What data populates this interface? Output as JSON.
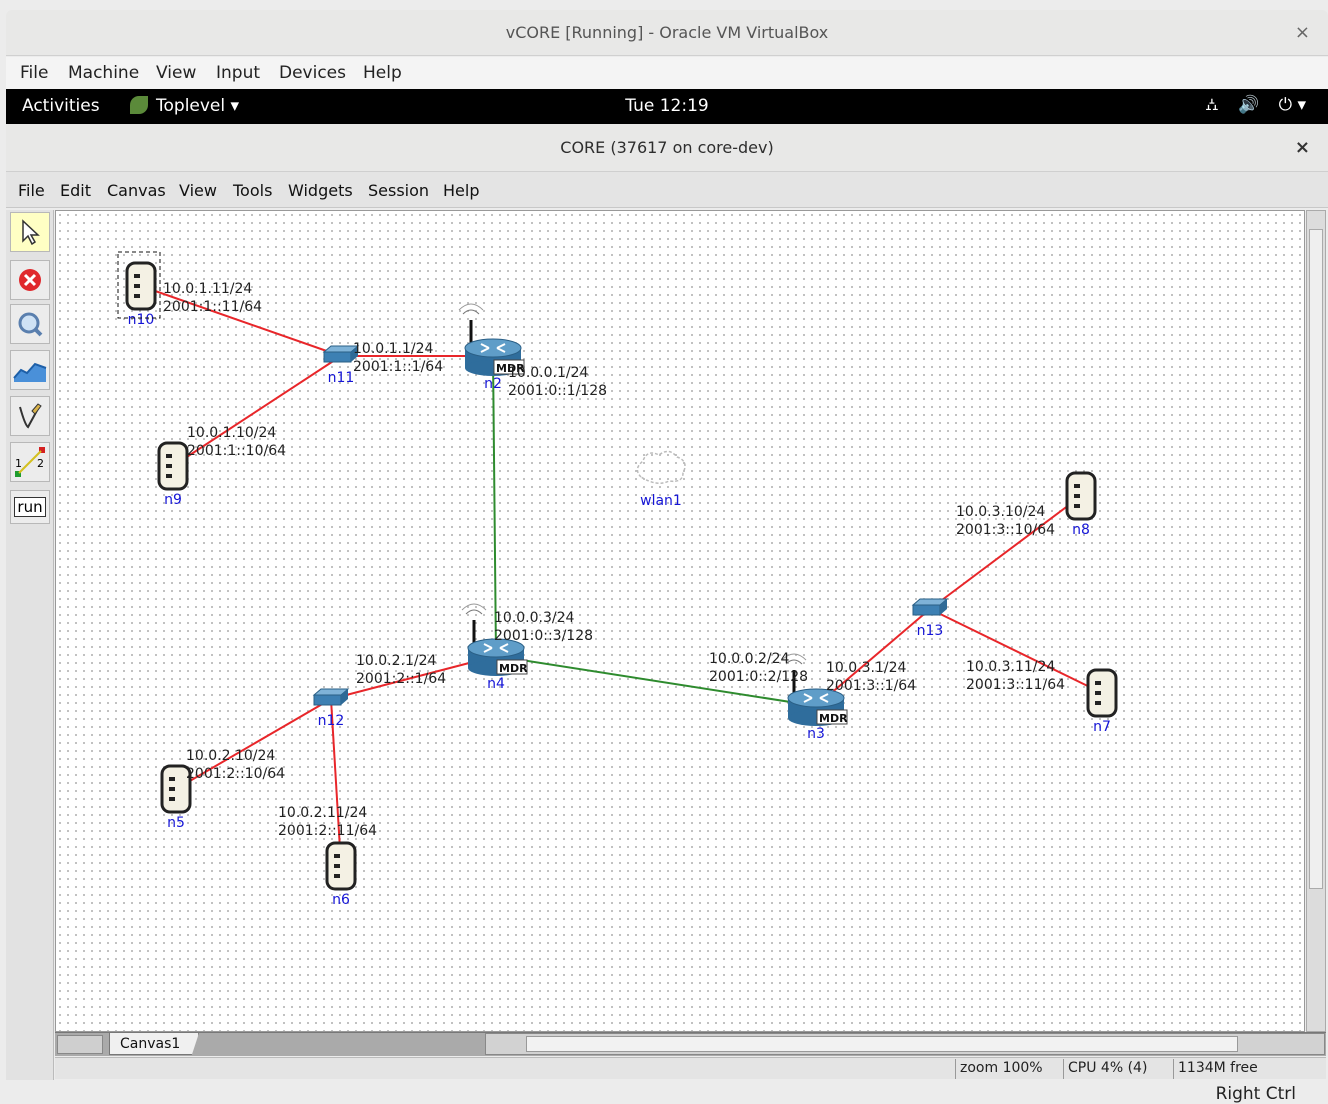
{
  "vbox": {
    "title": "vCORE [Running] - Oracle VM VirtualBox",
    "close": "×",
    "menu": [
      "File",
      "Machine",
      "View",
      "Input",
      "Devices",
      "Help"
    ],
    "host_key": "Right Ctrl"
  },
  "gnome": {
    "activities": "Activities",
    "app_menu": "Toplevel ▾",
    "clock": "Tue 12:19",
    "network_glyph": "⛼",
    "volume_glyph": "🔊",
    "power_glyph": "⏻ ▾"
  },
  "core": {
    "title": "CORE (37617 on core-dev)",
    "close": "×",
    "menu": [
      "File",
      "Edit",
      "Canvas",
      "View",
      "Tools",
      "Widgets",
      "Session",
      "Help"
    ],
    "toolbar_run_label": "run",
    "tab": "Canvas1",
    "status": {
      "zoom": "zoom 100%",
      "cpu": "CPU 4% (4)",
      "mem": "1134M free"
    }
  },
  "topology": {
    "nodes": [
      {
        "id": "n10",
        "kind": "host"
      },
      {
        "id": "n11",
        "kind": "switch"
      },
      {
        "id": "n2",
        "kind": "router",
        "badge": "MDR"
      },
      {
        "id": "n9",
        "kind": "host"
      },
      {
        "id": "wlan1",
        "kind": "wlan"
      },
      {
        "id": "n8",
        "kind": "host"
      },
      {
        "id": "n13",
        "kind": "switch"
      },
      {
        "id": "n7",
        "kind": "host"
      },
      {
        "id": "n4",
        "kind": "router",
        "badge": "MDR"
      },
      {
        "id": "n3",
        "kind": "router",
        "badge": "MDR"
      },
      {
        "id": "n12",
        "kind": "switch"
      },
      {
        "id": "n5",
        "kind": "host"
      },
      {
        "id": "n6",
        "kind": "host"
      }
    ],
    "links": [
      {
        "from": "n10",
        "to": "n11",
        "type": "wired",
        "a": [
          "10.0.1.11/24",
          "2001:1::11/64"
        ],
        "b": []
      },
      {
        "from": "n11",
        "to": "n2",
        "type": "wired",
        "a": [
          "10.0.1.1/24",
          "2001:1::1/64"
        ],
        "b": []
      },
      {
        "from": "n9",
        "to": "n11",
        "type": "wired",
        "a": [
          "10.0.1.10/24",
          "2001:1::10/64"
        ],
        "b": []
      },
      {
        "from": "n2",
        "to": "n4",
        "type": "wireless",
        "a": [
          "10.0.0.1/24",
          "2001:0::1/128"
        ],
        "b": []
      },
      {
        "from": "n4",
        "to": "n3",
        "type": "wireless",
        "a": [
          "10.0.0.3/24",
          "2001:0::3/128"
        ],
        "b": [
          "10.0.0.2/24",
          "2001:0::2/128"
        ]
      },
      {
        "from": "n12",
        "to": "n4",
        "type": "wired",
        "a": [
          "10.0.2.1/24",
          "2001:2::1/64"
        ],
        "b": []
      },
      {
        "from": "n5",
        "to": "n12",
        "type": "wired",
        "a": [
          "10.0.2.10/24",
          "2001:2::10/64"
        ],
        "b": []
      },
      {
        "from": "n6",
        "to": "n12",
        "type": "wired",
        "a": [
          "10.0.2.11/24",
          "2001:2::11/64"
        ],
        "b": []
      },
      {
        "from": "n3",
        "to": "n13",
        "type": "wired",
        "a": [
          "10.0.3.1/24",
          "2001:3::1/64"
        ],
        "b": []
      },
      {
        "from": "n8",
        "to": "n13",
        "type": "wired",
        "a": [
          "10.0.3.10/24",
          "2001:3::10/64"
        ],
        "b": []
      },
      {
        "from": "n7",
        "to": "n13",
        "type": "wired",
        "a": [
          "10.0.3.11/24",
          "2001:3::11/64"
        ],
        "b": []
      }
    ]
  },
  "colors": {
    "wired": "#e8262a",
    "wireless": "#2e8b2e",
    "label": "#1515d6"
  }
}
